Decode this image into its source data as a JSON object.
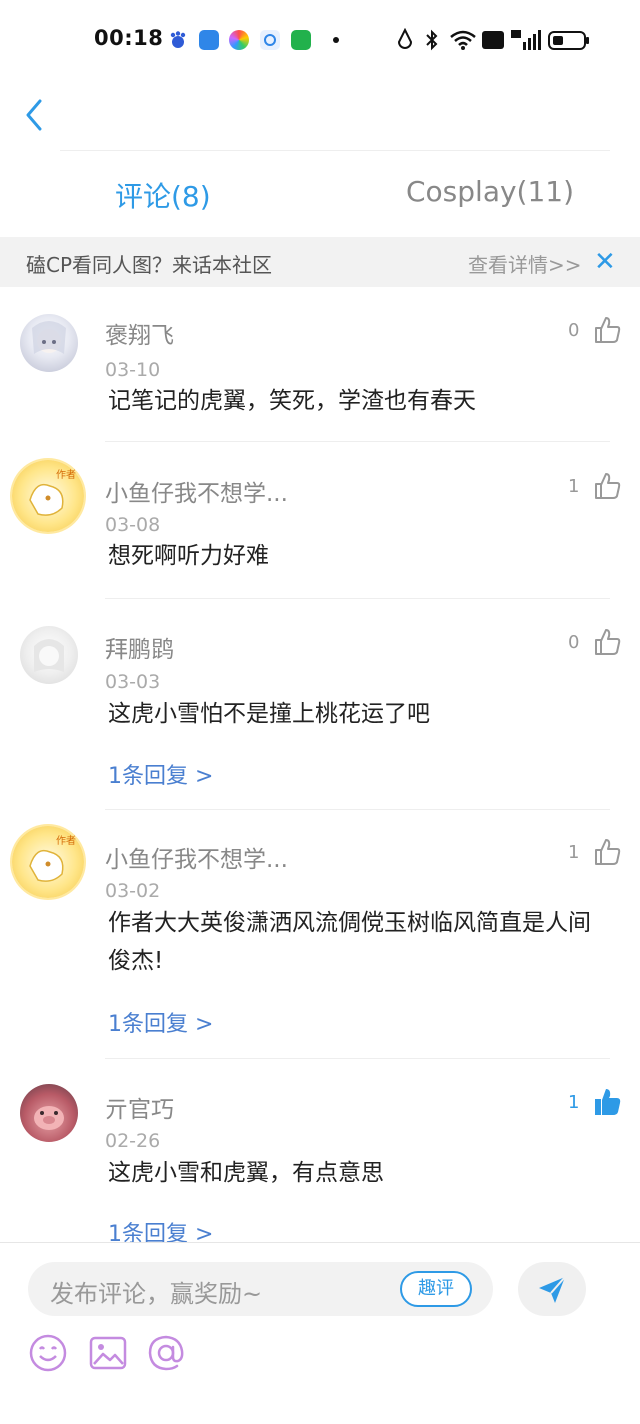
{
  "status_bar": {
    "time": "00:18"
  },
  "tabs": [
    {
      "label": "评论(8)",
      "active": true
    },
    {
      "label": "Cosplay(11)",
      "active": false
    }
  ],
  "banner": {
    "text": "磕CP看同人图？来话本社区",
    "link": "查看详情>>",
    "close": "✕"
  },
  "comments": [
    {
      "user": "褒翔飞",
      "date": "03-10",
      "text": "记笔记的虎翼，笑死，学渣也有春天",
      "likes": "0",
      "liked": false,
      "reply": ""
    },
    {
      "user": "小鱼仔我不想学...",
      "date": "03-08",
      "text": "想死啊听力好难",
      "likes": "1",
      "liked": false,
      "reply": ""
    },
    {
      "user": "拜鹏鹍",
      "date": "03-03",
      "text": "这虎小雪怕不是撞上桃花运了吧",
      "likes": "0",
      "liked": false,
      "reply": "1条回复 >"
    },
    {
      "user": "小鱼仔我不想学...",
      "date": "03-02",
      "text": "作者大大英俊潇洒风流倜傥玉树临风简直是人间俊杰!",
      "likes": "1",
      "liked": false,
      "reply": "1条回复 >"
    },
    {
      "user": "亓官巧",
      "date": "02-26",
      "text": "这虎小雪和虎翼，有点意思",
      "likes": "1",
      "liked": true,
      "reply": "1条回复 >"
    }
  ],
  "author_badge": "作者",
  "composer": {
    "placeholder": "发布评论，赢奖励~",
    "quick_comment": "趣评"
  },
  "colors": {
    "accent": "#2e9ae6",
    "reply_link": "#4a7fd0"
  }
}
